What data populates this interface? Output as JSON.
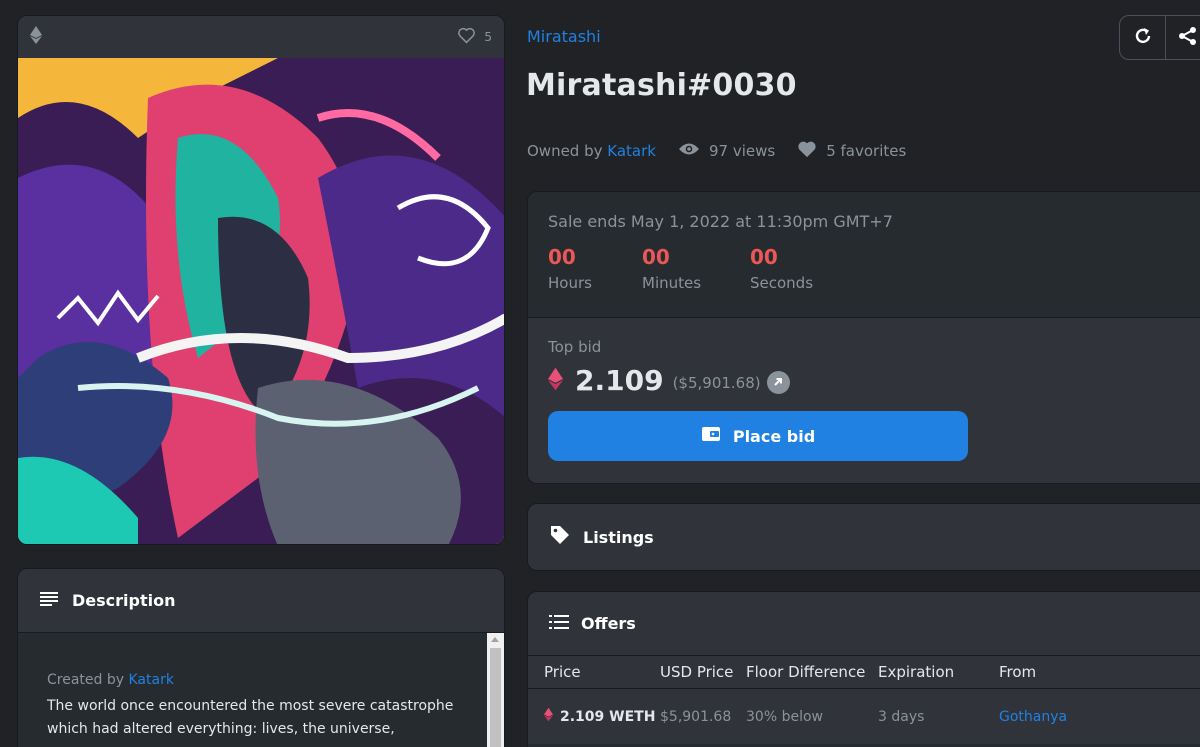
{
  "image_card": {
    "favorites_count": "5"
  },
  "description": {
    "title": "Description",
    "created_by_prefix": "Created by",
    "creator": "Katark",
    "text_line1": "The world once encountered the most severe catastrophe",
    "text_line2": "which had altered everything: lives, the universe,"
  },
  "collection_name": "Miratashi",
  "item_title": "Miratashi#0030",
  "meta": {
    "owned_by_prefix": "Owned by",
    "owner": "Katark",
    "views": "97 views",
    "favorites": "5 favorites"
  },
  "sale": {
    "ends_text": "Sale ends May 1, 2022 at 11:30pm GMT+7",
    "countdown": [
      {
        "value": "00",
        "label": "Hours"
      },
      {
        "value": "00",
        "label": "Minutes"
      },
      {
        "value": "00",
        "label": "Seconds"
      }
    ],
    "top_bid_label": "Top bid",
    "price": "2.109",
    "price_usd": "($5,901.68)",
    "button_label": "Place bid"
  },
  "listings": {
    "title": "Listings"
  },
  "offers": {
    "title": "Offers",
    "columns": [
      "Price",
      "USD Price",
      "Floor Difference",
      "Expiration",
      "From"
    ],
    "rows": [
      {
        "price": "2.109 WETH",
        "usd": "$5,901.68",
        "floor": "30% below",
        "expiration": "3 days",
        "from": "Gothanya"
      }
    ]
  },
  "colors": {
    "accent": "#2081e2",
    "countdown": "#eb5757",
    "eth": "#e8507a"
  },
  "icons": [
    "ethereum-icon",
    "heart-icon",
    "eye-icon",
    "refresh-icon",
    "share-icon",
    "tag-icon",
    "list-icon",
    "wallet-icon",
    "arrow-up-right-icon"
  ]
}
